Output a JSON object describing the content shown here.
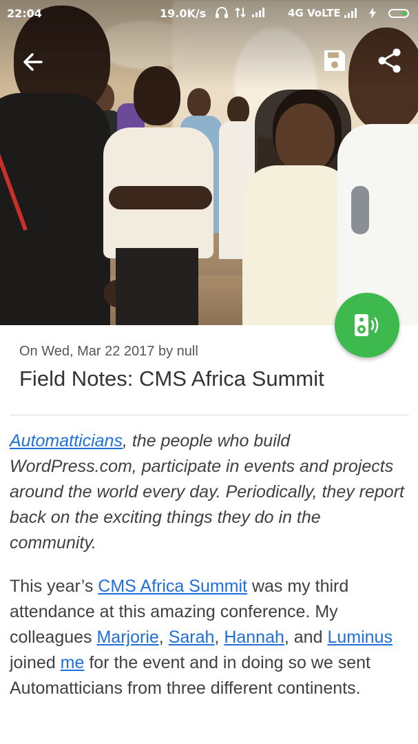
{
  "status_bar": {
    "time": "22:04",
    "network_speed": "19.0K/s",
    "network_type": "4G VoLTE",
    "battery_color": "#2ecc40"
  },
  "toolbar": {
    "back_icon": "arrow-left-icon",
    "save_icon": "floppy-disk-icon",
    "share_icon": "share-icon"
  },
  "fab": {
    "icon": "speaker-icon",
    "color": "#3db94d"
  },
  "article": {
    "meta": "On Wed, Mar 22 2017 by null",
    "title": "Field Notes: CMS Africa Summit",
    "intro": {
      "link": "Automatticians",
      "text": ", the people who build WordPress.com, participate in events and projects around the world every day. Periodically, they report back on the exciting things they do in the community."
    },
    "body": {
      "t1": "This year’s ",
      "link_summit": "CMS Africa Summit",
      "t2": " was my third attendance at this amazing conference. My colleagues ",
      "link_marjorie": "Marjorie",
      "sep1": ", ",
      "link_sarah": "Sarah",
      "sep2": ", ",
      "link_hannah": "Hannah",
      "t3": ", and ",
      "link_luminus": "Luminus",
      "t4": " joined ",
      "link_me": "me",
      "t5": " for the event and in doing so we sent Automatticians from three different continents."
    },
    "link_color": "#1e6fd9"
  }
}
